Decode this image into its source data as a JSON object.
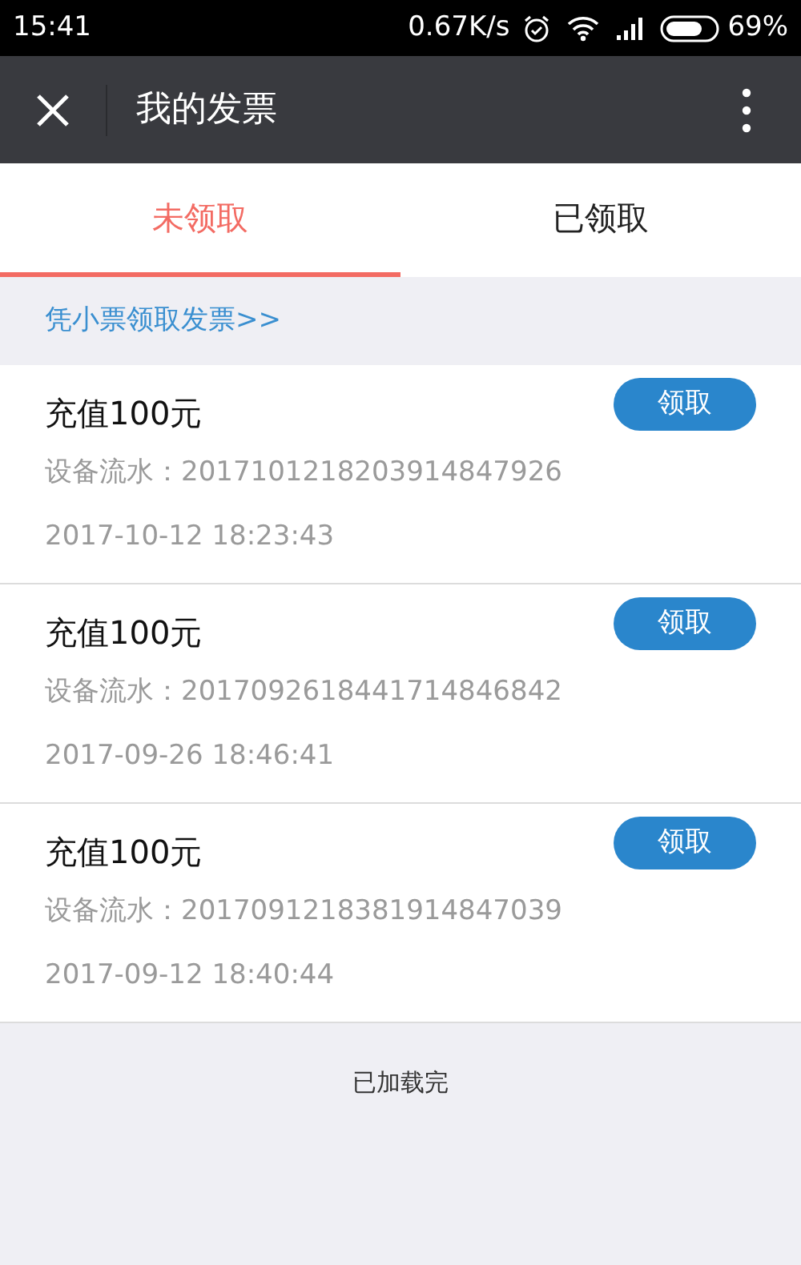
{
  "status_bar": {
    "time": "15:41",
    "speed": "0.67K/s",
    "battery": "69%"
  },
  "header": {
    "title": "我的发票"
  },
  "tabs": [
    {
      "label": "未领取",
      "selected": true
    },
    {
      "label": "已领取",
      "selected": false
    }
  ],
  "link": "凭小票领取发票>>",
  "invoices": [
    {
      "title": "充值100元",
      "serial": "设备流水：2017101218203914847926",
      "time": "2017-10-12 18:23:43",
      "button": "领取"
    },
    {
      "title": "充值100元",
      "serial": "设备流水：2017092618441714846842",
      "time": "2017-09-26 18:46:41",
      "button": "领取"
    },
    {
      "title": "充值100元",
      "serial": "设备流水：2017091218381914847039",
      "time": "2017-09-12 18:40:44",
      "button": "领取"
    }
  ],
  "footer": "已加载完"
}
